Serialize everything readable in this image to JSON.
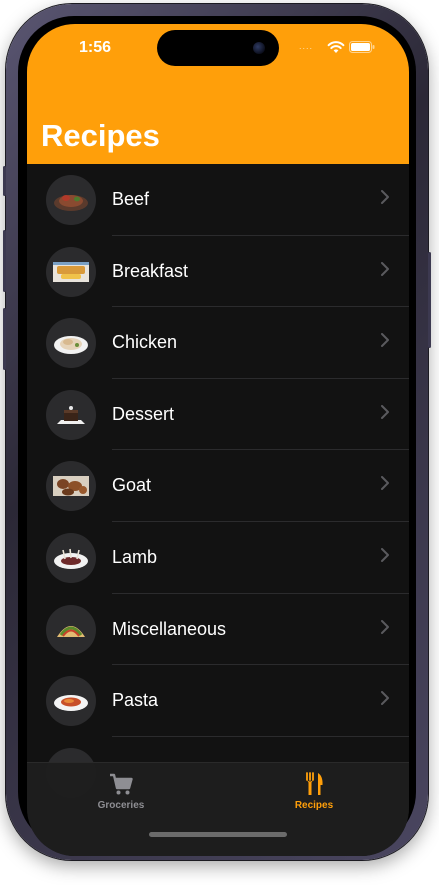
{
  "status": {
    "time": "1:56",
    "signal": "....",
    "wifi_icon": "wifi-icon",
    "battery_icon": "battery-icon"
  },
  "header": {
    "title": "Recipes",
    "background": "#ff9f0a"
  },
  "categories": [
    {
      "label": "Beef",
      "thumbnail": "beef-dish"
    },
    {
      "label": "Breakfast",
      "thumbnail": "breakfast-dish"
    },
    {
      "label": "Chicken",
      "thumbnail": "chicken-dish"
    },
    {
      "label": "Dessert",
      "thumbnail": "dessert-dish"
    },
    {
      "label": "Goat",
      "thumbnail": "goat-dish"
    },
    {
      "label": "Lamb",
      "thumbnail": "lamb-dish"
    },
    {
      "label": "Miscellaneous",
      "thumbnail": "miscellaneous-dish"
    },
    {
      "label": "Pasta",
      "thumbnail": "pasta-dish"
    }
  ],
  "tabbar": {
    "tabs": [
      {
        "label": "Groceries",
        "icon": "cart-icon",
        "selected": false
      },
      {
        "label": "Recipes",
        "icon": "fork-knife-icon",
        "selected": true
      }
    ],
    "selected_color": "#ff9f0a",
    "unselected_color": "#8e8e93"
  }
}
